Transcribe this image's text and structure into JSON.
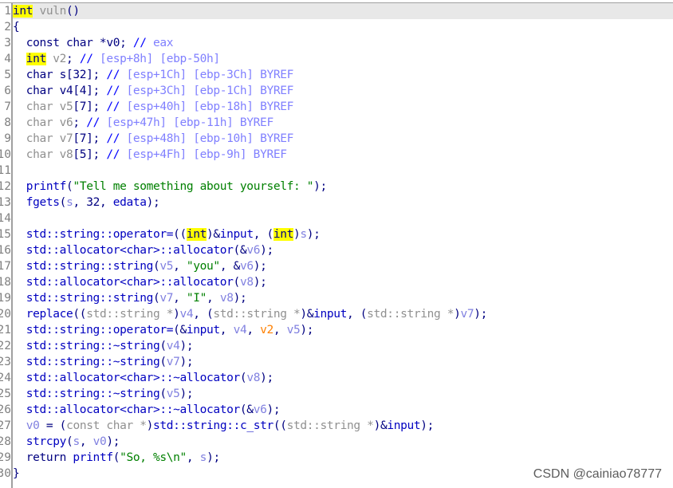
{
  "colors": {
    "highlight": "#ffff00",
    "current_line": "#e8e8e8",
    "string": "#008000",
    "function": "#0000c0",
    "variable": "#8080e0",
    "arg_orange": "#ff8000"
  },
  "watermark": "CSDN @cainiao78777",
  "lines": [
    [
      [
        "int",
        "y"
      ],
      [
        " vuln",
        "g"
      ],
      [
        "()",
        "p"
      ]
    ],
    [
      [
        "{",
        "p"
      ]
    ],
    [
      [
        "  const char *v0; ",
        "k"
      ],
      [
        "// ",
        "cm"
      ],
      [
        "eax",
        "c"
      ]
    ],
    [
      [
        "  ",
        "p"
      ],
      [
        "int",
        "y"
      ],
      [
        " v2",
        "g"
      ],
      [
        "; ",
        "p"
      ],
      [
        "// ",
        "cm"
      ],
      [
        "[esp+8h] [ebp-50h]",
        "c"
      ]
    ],
    [
      [
        "  char s[32]; ",
        "k"
      ],
      [
        "// ",
        "cm"
      ],
      [
        "[esp+1Ch] [ebp-3Ch] BYREF",
        "c"
      ]
    ],
    [
      [
        "  char v4[4]; ",
        "k"
      ],
      [
        "// ",
        "cm"
      ],
      [
        "[esp+3Ch] [ebp-1Ch] BYREF",
        "c"
      ]
    ],
    [
      [
        "  char v5",
        "g"
      ],
      [
        "[7]; ",
        "p"
      ],
      [
        "// ",
        "cm"
      ],
      [
        "[esp+40h] [ebp-18h] BYREF",
        "c"
      ]
    ],
    [
      [
        "  char v6",
        "g"
      ],
      [
        "; ",
        "p"
      ],
      [
        "// ",
        "cm"
      ],
      [
        "[esp+47h] [ebp-11h] BYREF",
        "c"
      ]
    ],
    [
      [
        "  char v7",
        "g"
      ],
      [
        "[7]; ",
        "p"
      ],
      [
        "// ",
        "cm"
      ],
      [
        "[esp+48h] [ebp-10h] BYREF",
        "c"
      ]
    ],
    [
      [
        "  char v8",
        "g"
      ],
      [
        "[5]; ",
        "p"
      ],
      [
        "// ",
        "cm"
      ],
      [
        "[esp+4Fh] [ebp-9h] BYREF",
        "c"
      ]
    ],
    [],
    [
      [
        "  printf",
        "f"
      ],
      [
        "(",
        "p"
      ],
      [
        "\"Tell me something about yourself: \"",
        "s"
      ],
      [
        ");",
        "p"
      ]
    ],
    [
      [
        "  fgets",
        "f"
      ],
      [
        "(",
        "p"
      ],
      [
        "s",
        "v"
      ],
      [
        ", 32, ",
        "p"
      ],
      [
        "edata",
        "f"
      ],
      [
        ");",
        "p"
      ]
    ],
    [],
    [
      [
        "  std::string::operator=",
        "f"
      ],
      [
        "((",
        "p"
      ],
      [
        "int",
        "y"
      ],
      [
        ")&",
        "p"
      ],
      [
        "input",
        "f"
      ],
      [
        ", (",
        "p"
      ],
      [
        "int",
        "y"
      ],
      [
        ")",
        "p"
      ],
      [
        "s",
        "v"
      ],
      [
        ");",
        "p"
      ]
    ],
    [
      [
        "  std::allocator<char>::allocator",
        "f"
      ],
      [
        "(&",
        "p"
      ],
      [
        "v6",
        "v"
      ],
      [
        ");",
        "p"
      ]
    ],
    [
      [
        "  std::string::string",
        "f"
      ],
      [
        "(",
        "p"
      ],
      [
        "v5",
        "v"
      ],
      [
        ", ",
        "p"
      ],
      [
        "\"you\"",
        "s"
      ],
      [
        ", &",
        "p"
      ],
      [
        "v6",
        "v"
      ],
      [
        ");",
        "p"
      ]
    ],
    [
      [
        "  std::allocator<char>::allocator",
        "f"
      ],
      [
        "(",
        "p"
      ],
      [
        "v8",
        "v"
      ],
      [
        ");",
        "p"
      ]
    ],
    [
      [
        "  std::string::string",
        "f"
      ],
      [
        "(",
        "p"
      ],
      [
        "v7",
        "v"
      ],
      [
        ", ",
        "p"
      ],
      [
        "\"I\"",
        "s"
      ],
      [
        ", ",
        "p"
      ],
      [
        "v8",
        "v"
      ],
      [
        ");",
        "p"
      ]
    ],
    [
      [
        "  replace",
        "f"
      ],
      [
        "((",
        "p"
      ],
      [
        "std::string *",
        "g"
      ],
      [
        ")",
        "p"
      ],
      [
        "v4",
        "v"
      ],
      [
        ", (",
        "p"
      ],
      [
        "std::string *",
        "g"
      ],
      [
        ")&",
        "p"
      ],
      [
        "input",
        "f"
      ],
      [
        ", (",
        "p"
      ],
      [
        "std::string *",
        "g"
      ],
      [
        ")",
        "p"
      ],
      [
        "v7",
        "v"
      ],
      [
        ");",
        "p"
      ]
    ],
    [
      [
        "  std::string::operator=",
        "f"
      ],
      [
        "(&",
        "p"
      ],
      [
        "input",
        "f"
      ],
      [
        ", ",
        "p"
      ],
      [
        "v4",
        "v"
      ],
      [
        ", ",
        "p"
      ],
      [
        "v2",
        "o"
      ],
      [
        ", ",
        "p"
      ],
      [
        "v5",
        "v"
      ],
      [
        ");",
        "p"
      ]
    ],
    [
      [
        "  std::string::~string",
        "f"
      ],
      [
        "(",
        "p"
      ],
      [
        "v4",
        "v"
      ],
      [
        ");",
        "p"
      ]
    ],
    [
      [
        "  std::string::~string",
        "f"
      ],
      [
        "(",
        "p"
      ],
      [
        "v7",
        "v"
      ],
      [
        ");",
        "p"
      ]
    ],
    [
      [
        "  std::allocator<char>::~allocator",
        "f"
      ],
      [
        "(",
        "p"
      ],
      [
        "v8",
        "v"
      ],
      [
        ");",
        "p"
      ]
    ],
    [
      [
        "  std::string::~string",
        "f"
      ],
      [
        "(",
        "p"
      ],
      [
        "v5",
        "v"
      ],
      [
        ");",
        "p"
      ]
    ],
    [
      [
        "  std::allocator<char>::~allocator",
        "f"
      ],
      [
        "(&",
        "p"
      ],
      [
        "v6",
        "v"
      ],
      [
        ");",
        "p"
      ]
    ],
    [
      [
        "  v0",
        "v"
      ],
      [
        " = (",
        "p"
      ],
      [
        "const char *",
        "g"
      ],
      [
        ")",
        "p"
      ],
      [
        "std::string::c_str",
        "f"
      ],
      [
        "((",
        "p"
      ],
      [
        "std::string *",
        "g"
      ],
      [
        ")&",
        "p"
      ],
      [
        "input",
        "f"
      ],
      [
        ");",
        "p"
      ]
    ],
    [
      [
        "  strcpy",
        "f"
      ],
      [
        "(",
        "p"
      ],
      [
        "s",
        "v"
      ],
      [
        ", ",
        "p"
      ],
      [
        "v0",
        "v"
      ],
      [
        ");",
        "p"
      ]
    ],
    [
      [
        "  return ",
        "k"
      ],
      [
        "printf",
        "f"
      ],
      [
        "(",
        "p"
      ],
      [
        "\"So, %s\\n\"",
        "s"
      ],
      [
        ", ",
        "p"
      ],
      [
        "s",
        "v"
      ],
      [
        ");",
        "p"
      ]
    ],
    [
      [
        "}",
        "p"
      ]
    ]
  ]
}
